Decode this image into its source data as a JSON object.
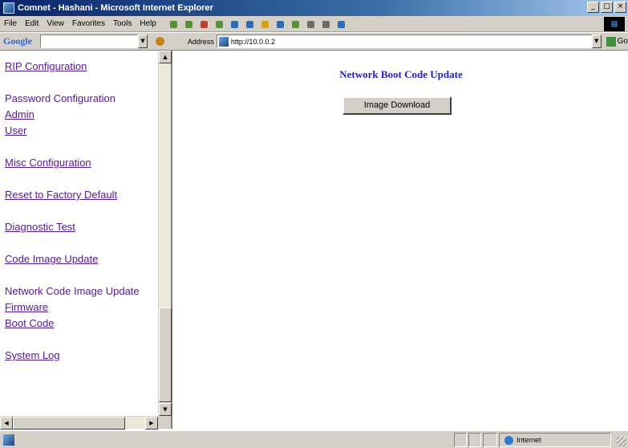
{
  "window": {
    "title": "Comnet - Hashani - Microsoft Internet Explorer",
    "controls": [
      "_",
      "□",
      "×"
    ]
  },
  "menubar": {
    "items": [
      "File",
      "Edit",
      "View",
      "Favorites",
      "Tools",
      "Help"
    ]
  },
  "addressbar": {
    "google_label": "Google",
    "address_label": "Address",
    "url": "http://10.0.0.2",
    "go_label": "Go"
  },
  "nav": {
    "rip": "RIP Configuration",
    "password_heading": "Password Configuration",
    "admin": "Admin",
    "user": "User",
    "misc": "Misc Configuration",
    "reset": "Reset to Factory Default",
    "diagnostic": "Diagnostic Test",
    "code_image": "Code Image Update",
    "network_heading": "Network Code Image Update",
    "firmware": "Firmware",
    "boot_code": "Boot Code",
    "system_log": "System Log"
  },
  "main": {
    "heading": "Network Boot Code Update",
    "button_label": "Image Download"
  },
  "status": {
    "zone": "Internet"
  }
}
